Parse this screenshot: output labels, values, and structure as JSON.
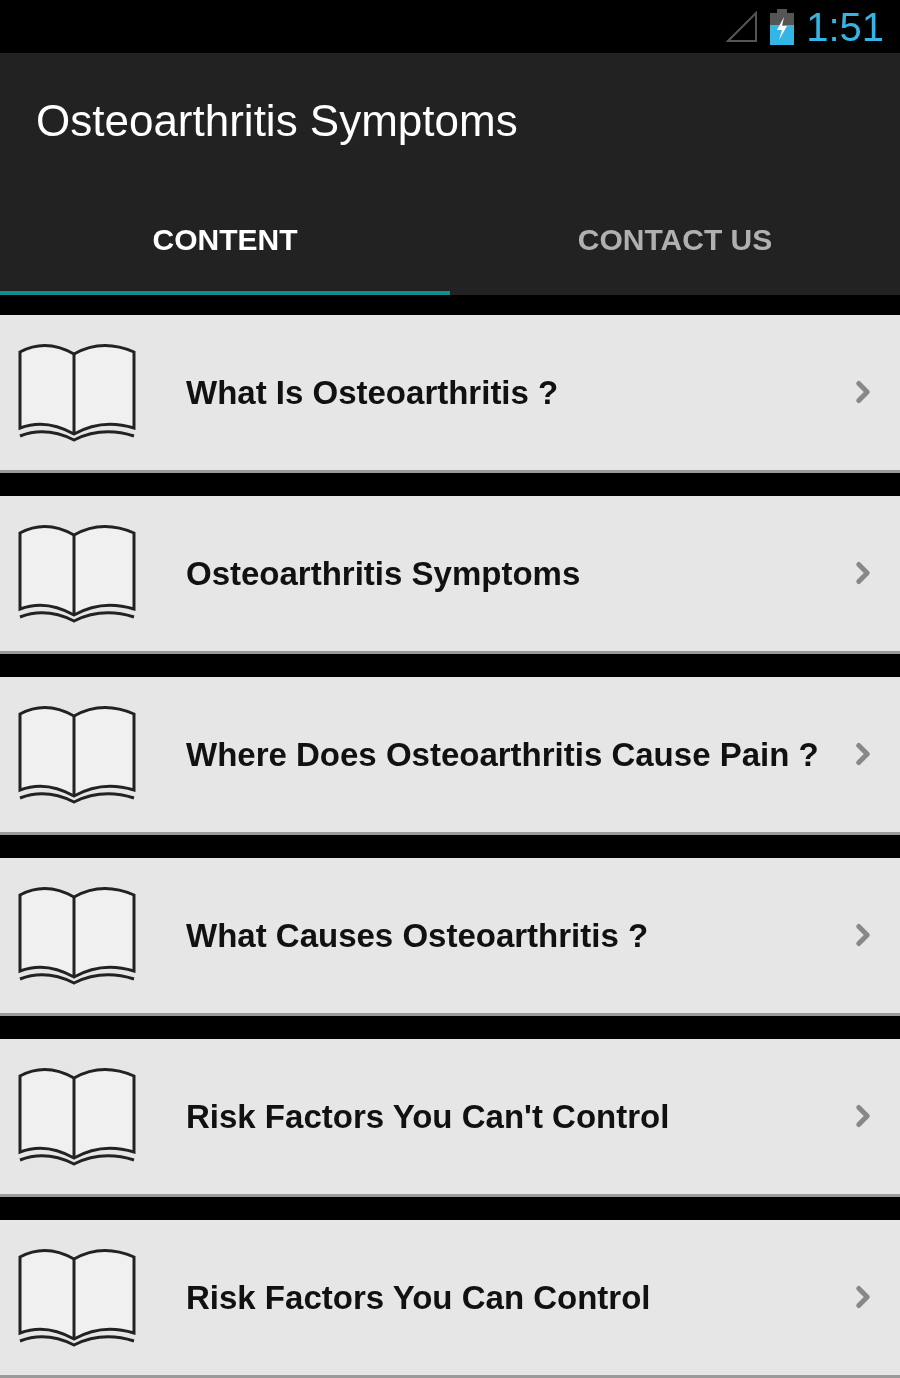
{
  "status_bar": {
    "time": "1:51"
  },
  "app_bar": {
    "title": "Osteoarthritis Symptoms"
  },
  "tabs": [
    {
      "label": "CONTENT",
      "selected": true
    },
    {
      "label": "CONTACT US",
      "selected": false
    }
  ],
  "items": [
    {
      "label": "What Is Osteoarthritis ?"
    },
    {
      "label": "Osteoarthritis Symptoms"
    },
    {
      "label": "Where Does Osteoarthritis Cause Pain ?"
    },
    {
      "label": "What Causes Osteoarthritis ?"
    },
    {
      "label": "Risk Factors You Can't Control"
    },
    {
      "label": "Risk Factors You Can Control"
    }
  ]
}
